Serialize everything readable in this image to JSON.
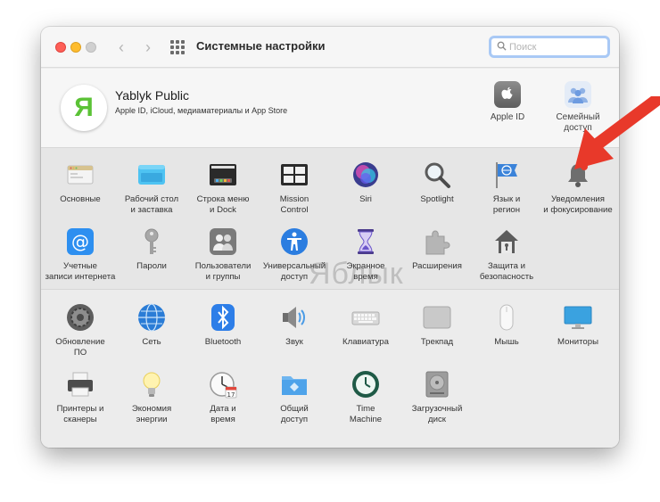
{
  "window": {
    "title": "Системные настройки"
  },
  "search": {
    "placeholder": "Поиск"
  },
  "account": {
    "avatar_letter": "Я",
    "name": "Yablyk Public",
    "subtitle": "Apple ID, iCloud, медиаматериалы и App Store",
    "icons": [
      {
        "label": "Apple ID",
        "icon": "apple-id-icon"
      },
      {
        "label": "Семейный\nдоступ",
        "icon": "family-sharing-icon"
      }
    ]
  },
  "section1": {
    "items": [
      {
        "label": "Основные",
        "icon": "general-icon"
      },
      {
        "label": "Рабочий стол\nи заставка",
        "icon": "desktop-icon"
      },
      {
        "label": "Строка меню\nи Dock",
        "icon": "dock-icon"
      },
      {
        "label": "Mission\nControl",
        "icon": "mission-control-icon"
      },
      {
        "label": "Siri",
        "icon": "siri-icon"
      },
      {
        "label": "Spotlight",
        "icon": "spotlight-icon"
      },
      {
        "label": "Язык и\nрегион",
        "icon": "language-icon"
      },
      {
        "label": "Уведомления\nи фокусирование",
        "icon": "notifications-icon"
      },
      {
        "label": "Учетные\nзаписи интернета",
        "icon": "internet-accounts-icon"
      },
      {
        "label": "Пароли",
        "icon": "passwords-icon"
      },
      {
        "label": "Пользователи\nи группы",
        "icon": "users-icon"
      },
      {
        "label": "Универсальный\nдоступ",
        "icon": "accessibility-icon"
      },
      {
        "label": "Экранное\nвремя",
        "icon": "screen-time-icon"
      },
      {
        "label": "Расширения",
        "icon": "extensions-icon"
      },
      {
        "label": "Защита и\nбезопасность",
        "icon": "security-icon"
      }
    ]
  },
  "section2": {
    "items": [
      {
        "label": "Обновление\nПО",
        "icon": "software-update-icon"
      },
      {
        "label": "Сеть",
        "icon": "network-icon"
      },
      {
        "label": "Bluetooth",
        "icon": "bluetooth-icon"
      },
      {
        "label": "Звук",
        "icon": "sound-icon"
      },
      {
        "label": "Клавиатура",
        "icon": "keyboard-icon"
      },
      {
        "label": "Трекпад",
        "icon": "trackpad-icon"
      },
      {
        "label": "Мышь",
        "icon": "mouse-icon"
      },
      {
        "label": "Мониторы",
        "icon": "displays-icon"
      },
      {
        "label": "Принтеры и\nсканеры",
        "icon": "printers-icon"
      },
      {
        "label": "Экономия\nэнергии",
        "icon": "energy-icon"
      },
      {
        "label": "Дата и\nвремя",
        "icon": "date-time-icon"
      },
      {
        "label": "Общий\nдоступ",
        "icon": "sharing-icon"
      },
      {
        "label": "Time\nMachine",
        "icon": "time-machine-icon"
      },
      {
        "label": "Загрузочный\nдиск",
        "icon": "startup-disk-icon"
      }
    ]
  },
  "watermark": "Яблык",
  "colors": {
    "arrow": "#e8392a",
    "avatar_letter": "#5bc236",
    "search_focus": "#a9c9f5"
  }
}
